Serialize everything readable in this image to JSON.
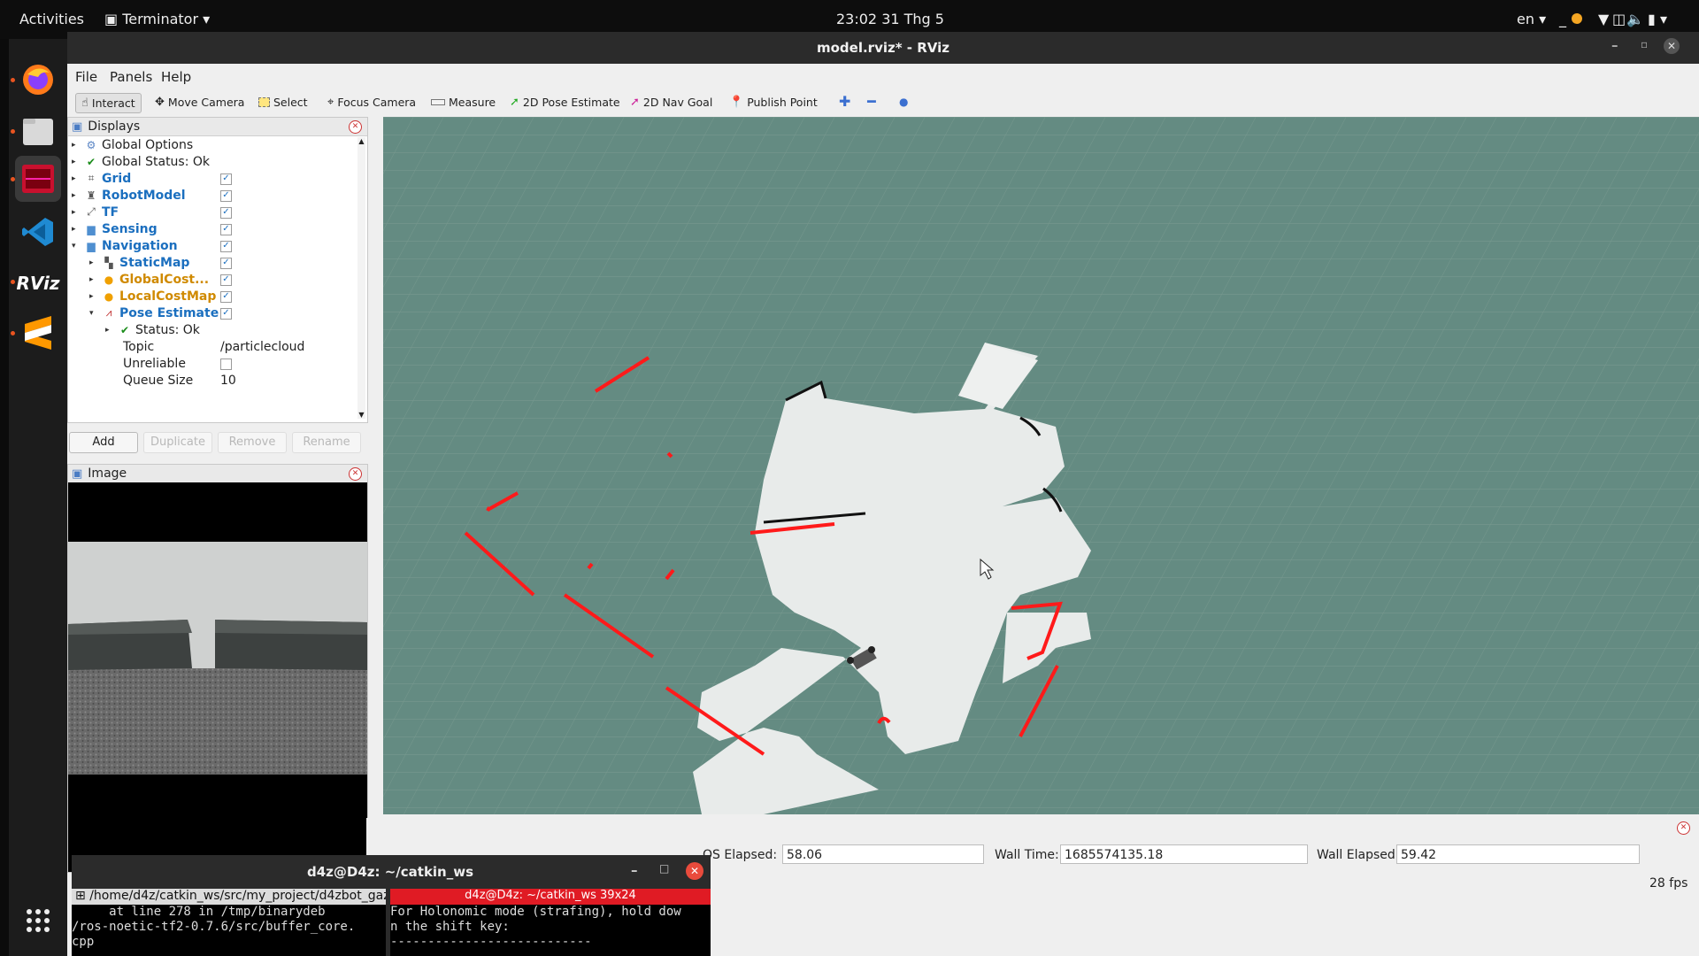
{
  "topbar": {
    "activities": "Activities",
    "app_name": "Terminator",
    "clock": "23:02  31 Thg 5",
    "lang": "en"
  },
  "dock": {
    "items": [
      "firefox-icon",
      "files-icon",
      "terminator-icon",
      "vscode-icon",
      "rviz-icon",
      "sublime-icon",
      "app-grid-icon"
    ],
    "rviz_label": "RViz"
  },
  "rviz": {
    "title": "model.rviz* - RViz",
    "menu": [
      "File",
      "Panels",
      "Help"
    ],
    "toolbar": [
      "Interact",
      "Move Camera",
      "Select",
      "Focus Camera",
      "Measure",
      "2D Pose Estimate",
      "2D Nav Goal",
      "Publish Point"
    ],
    "displays": {
      "title": "Displays",
      "rows": [
        {
          "label": "Global Options"
        },
        {
          "label": "Global Status: Ok"
        },
        {
          "label": "Grid",
          "checked": true
        },
        {
          "label": "RobotModel",
          "checked": true
        },
        {
          "label": "TF",
          "checked": true
        },
        {
          "label": "Sensing",
          "checked": true
        },
        {
          "label": "Navigation",
          "checked": true
        },
        {
          "label": "StaticMap",
          "checked": true
        },
        {
          "label": "GlobalCost...",
          "checked": true
        },
        {
          "label": "LocalCostMap",
          "checked": true
        },
        {
          "label": "Pose Estimate",
          "checked": true
        },
        {
          "label": "Status: Ok"
        },
        {
          "label": "Topic",
          "value": "/particlecloud"
        },
        {
          "label": "Unreliable",
          "checked": false
        },
        {
          "label": "Queue Size",
          "value": "10"
        }
      ],
      "buttons": [
        "Add",
        "Duplicate",
        "Remove",
        "Rename"
      ]
    },
    "image_panel": {
      "title": "Image"
    },
    "time": {
      "ros_elapsed_label": "OS Elapsed:",
      "ros_elapsed": "58.06",
      "wall_time_label": "Wall Time:",
      "wall_time": "1685574135.18",
      "wall_elapsed_label": "Wall Elapsed:",
      "wall_elapsed": "59.42",
      "fps": "28 fps"
    }
  },
  "terminator": {
    "title": "d4z@D4z: ~/catkin_ws",
    "left_tab": "/home/d4z/catkin_ws/src/my_project/d4zbot_gaz",
    "left_lines": [
      "     at line 278 in /tmp/binarydeb",
      "/ros-noetic-tf2-0.7.6/src/buffer_core.",
      "cpp"
    ],
    "right_tab": "d4z@D4z: ~/catkin_ws 39x24",
    "right_lines": [
      "For Holonomic mode (strafing), hold dow",
      "n the shift key:",
      "---------------------------"
    ]
  },
  "colors": {
    "grid_bg": "#648b82",
    "map_free": "#e9eceb",
    "laser": "#ff1a1a",
    "accent": "#e95420"
  }
}
